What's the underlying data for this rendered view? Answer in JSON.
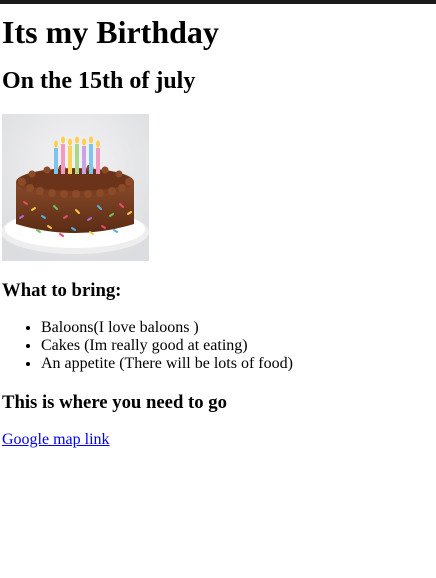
{
  "page": {
    "heading": "Its my Birthday",
    "subheading": "On the 15th of july"
  },
  "image": {
    "name": "birthday-cake"
  },
  "bring": {
    "heading": "What to bring:",
    "items": [
      "Baloons(I love baloons )",
      "Cakes (Im really good at eating)",
      "An appetite (There will be lots of food)"
    ]
  },
  "location": {
    "heading": "This is where you need to go",
    "link_text": "Google map link"
  },
  "colors": {
    "link": "#0000ee",
    "top_bar": "#1a1a1a"
  }
}
